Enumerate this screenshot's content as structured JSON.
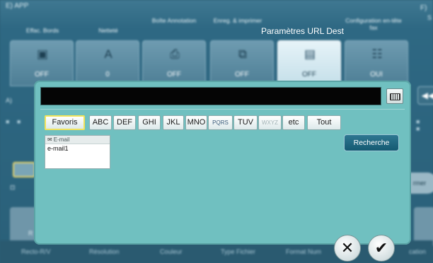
{
  "background": {
    "app_title": "E) APP",
    "right_label_f": "F)",
    "right_label_s": "S",
    "section_label": "A)",
    "tabs": [
      {
        "label": "Effac. Bords",
        "icon": "erase-border-icon",
        "value": "OFF"
      },
      {
        "label": "Netteté",
        "icon": "sharpness-icon",
        "value": "0"
      },
      {
        "label": "Boîte Annotation",
        "icon": "annotation-box-icon",
        "value": "OFF"
      },
      {
        "label": "Enreg. & imprimer",
        "icon": "save-print-icon",
        "value": "OFF"
      },
      {
        "label": "Paramètres URL Dest",
        "icon": "url-destination-icon",
        "value": "OFF"
      },
      {
        "label": "Configuration en-tête fax",
        "icon": "fax-header-icon",
        "value": "OUI"
      }
    ],
    "side_right_label": "rmer",
    "bottom_labels": [
      "Recto-R/V",
      "Résolution",
      "Couleur",
      "Type Fichier",
      "Format Num",
      "cation"
    ],
    "side_box_label": "R"
  },
  "dialog": {
    "title": "Paramètres URL Dest",
    "url_value": "",
    "filters": [
      {
        "label": "Favoris",
        "selected": true
      },
      {
        "label": "ABC"
      },
      {
        "label": "DEF"
      },
      {
        "label": "GHI"
      },
      {
        "label": "JKL"
      },
      {
        "label": "MNO"
      },
      {
        "label": "PQRS"
      },
      {
        "label": "TUV"
      },
      {
        "label": "WXYZ",
        "disabled": true
      },
      {
        "label": "etc"
      },
      {
        "label": "Tout"
      }
    ],
    "list_header": "E-mail",
    "list_items": [
      "e-mail1"
    ],
    "search_label": "Recherche",
    "cancel_symbol": "✕",
    "ok_symbol": "✔"
  },
  "colors": {
    "dialog_bg": "#70c0c0",
    "selected_border": "#f2e35a",
    "search_button": "#1f6882"
  }
}
